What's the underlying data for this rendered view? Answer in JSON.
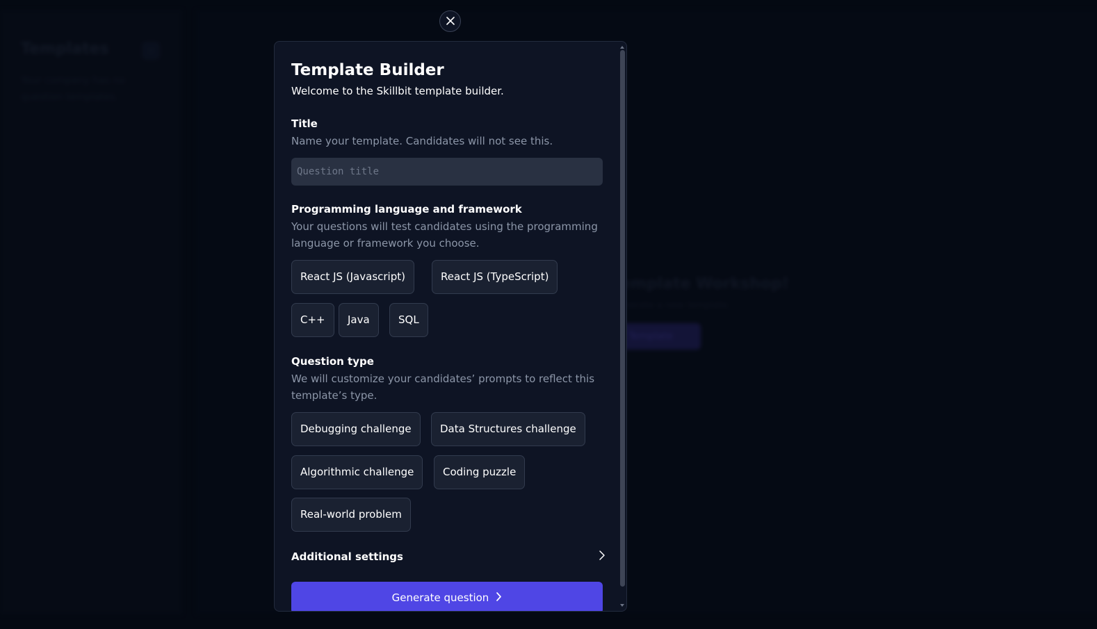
{
  "background": {
    "sidebar_title": "Templates",
    "sidebar_collapse_glyph": "«",
    "sidebar_description": "Your company has no question templates.",
    "empty_title": "Template Workshop!",
    "empty_subtitle": "Generate a new template.",
    "empty_button": "Template"
  },
  "modal": {
    "close_icon": "close-icon",
    "title": "Template Builder",
    "subtitle": "Welcome to the Skillbit template builder.",
    "title_section": {
      "label": "Title",
      "help": "Name your template. Candidates will not see this.",
      "input_value": "",
      "input_placeholder": "Question title"
    },
    "language_section": {
      "label": "Programming language and framework",
      "help": "Your questions will test candidates using the programming language or framework you choose.",
      "options": [
        "React JS (Javascript)",
        "React JS (TypeScript)",
        "C++",
        "Java",
        "SQL"
      ]
    },
    "type_section": {
      "label": "Question type",
      "help": "We will customize your candidates’ prompts to reflect this template’s type.",
      "options": [
        "Debugging challenge",
        "Data Structures challenge",
        "Algorithmic challenge",
        "Coding puzzle",
        "Real-world problem"
      ]
    },
    "additional_settings": "Additional settings",
    "generate_button": "Generate question"
  },
  "colors": {
    "accent": "#4f46e5",
    "modal_bg": "#0e1424",
    "chip_bg": "#1a2131",
    "muted_text": "#8c96a8"
  }
}
